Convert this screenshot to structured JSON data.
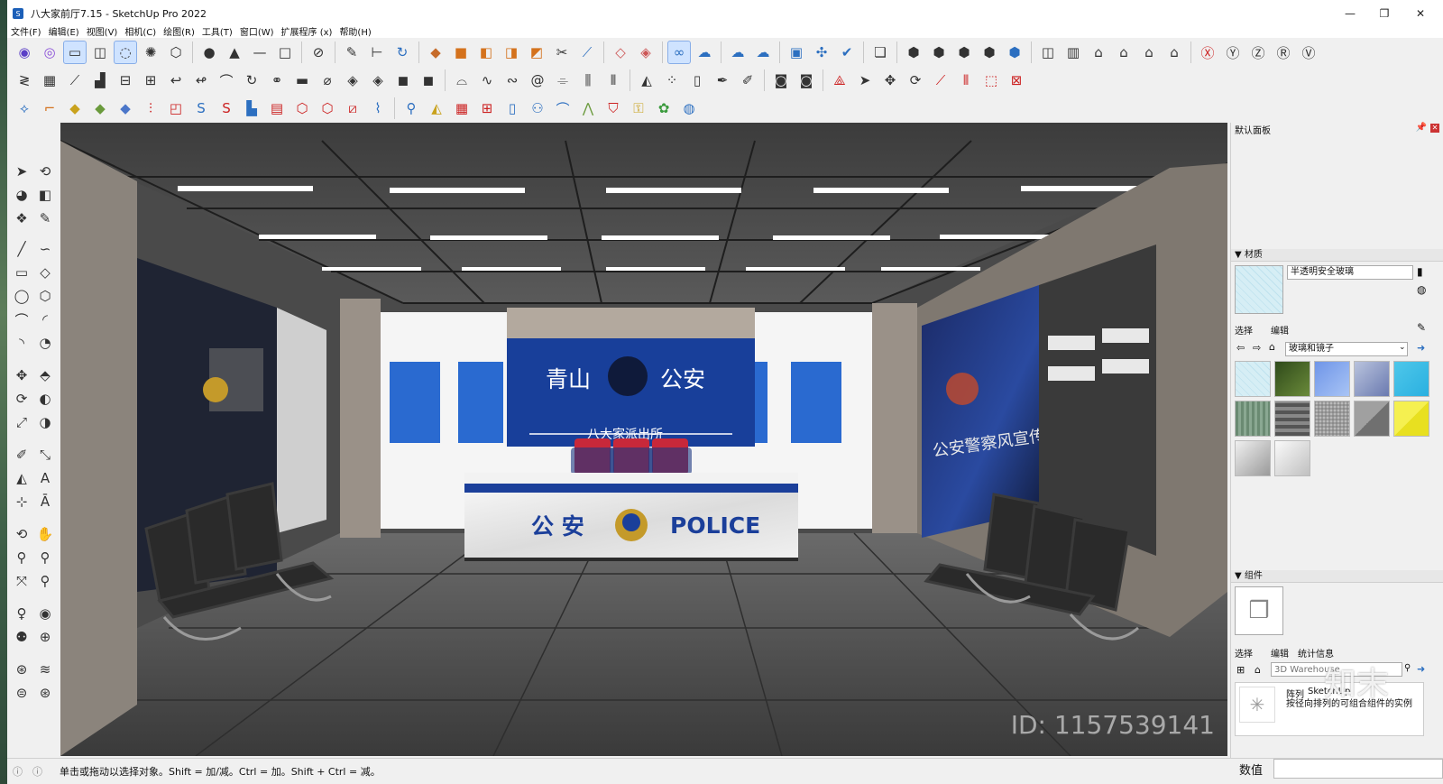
{
  "window": {
    "title": "八大家前厅7.15 - SketchUp Pro 2022",
    "min": "—",
    "max": "❐",
    "close": "✕"
  },
  "menu": [
    "文件(F)",
    "编辑(E)",
    "视图(V)",
    "相机(C)",
    "绘图(R)",
    "工具(T)",
    "窗口(W)",
    "扩展程序 (x)",
    "帮助(H)"
  ],
  "scene": {
    "sign_left": "青山",
    "sign_right": "公安",
    "sign_sub": "八大家派出所",
    "desk_left": "公 安",
    "desk_right": "POLICE",
    "wall_right": "公安警察风宣传"
  },
  "right_panel": {
    "title": "默认面板",
    "materials": {
      "header": "材质",
      "name": "半透明安全玻璃",
      "tab_select": "选择",
      "tab_edit": "编辑",
      "category": "玻璃和镜子"
    },
    "components": {
      "header": "组件",
      "tab_select": "选择",
      "tab_edit": "编辑",
      "tab_stats": "统计信息",
      "search_placeholder": "3D Warehouse",
      "desc_title": "阵列",
      "desc_brand": "SketchUp",
      "desc_text": "按径向排列的可组合组件的实例"
    },
    "measure_label": "数值"
  },
  "status": {
    "hint": "单击或拖动以选择对象。Shift = 加/减。Ctrl = 加。Shift + Ctrl = 减。"
  },
  "watermark": {
    "brand": "知末",
    "id": "ID: 1157539141"
  },
  "colors": {
    "accent": "#1c5fb8",
    "police_blue": "#183f9a",
    "panel_bg": "#f0f0f0"
  }
}
